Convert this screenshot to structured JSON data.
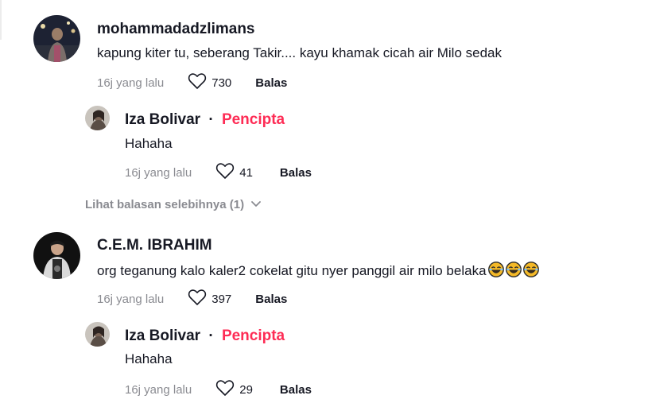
{
  "comments": [
    {
      "username": "mohammadadzlimans",
      "text": "kapung kiter tu, seberang Takir.... kayu khamak cicah air Milo sedak",
      "time": "16j yang lalu",
      "likes": "730",
      "reply_label": "Balas",
      "replies": [
        {
          "username": "Iza Bolivar",
          "separator": "·",
          "badge": "Pencipta",
          "text": "Hahaha",
          "time": "16j yang lalu",
          "likes": "41",
          "reply_label": "Balas"
        }
      ],
      "view_more_label": "Lihat balasan selebihnya (1)"
    },
    {
      "username": "C.E.M. IBRAHIM",
      "text": "org teganung kalo kaler2 cokelat gitu nyer panggil air milo belaka",
      "emojis": [
        "face-with-tears-of-joy",
        "face-with-tears-of-joy",
        "face-with-tears-of-joy"
      ],
      "time": "16j yang lalu",
      "likes": "397",
      "reply_label": "Balas",
      "replies": [
        {
          "username": "Iza Bolivar",
          "separator": "·",
          "badge": "Pencipta",
          "text": "Hahaha",
          "time": "16j yang lalu",
          "likes": "29",
          "reply_label": "Balas"
        }
      ]
    }
  ],
  "colors": {
    "creator_badge": "#fe2c55",
    "muted": "#8a8b91",
    "text": "#161823"
  }
}
